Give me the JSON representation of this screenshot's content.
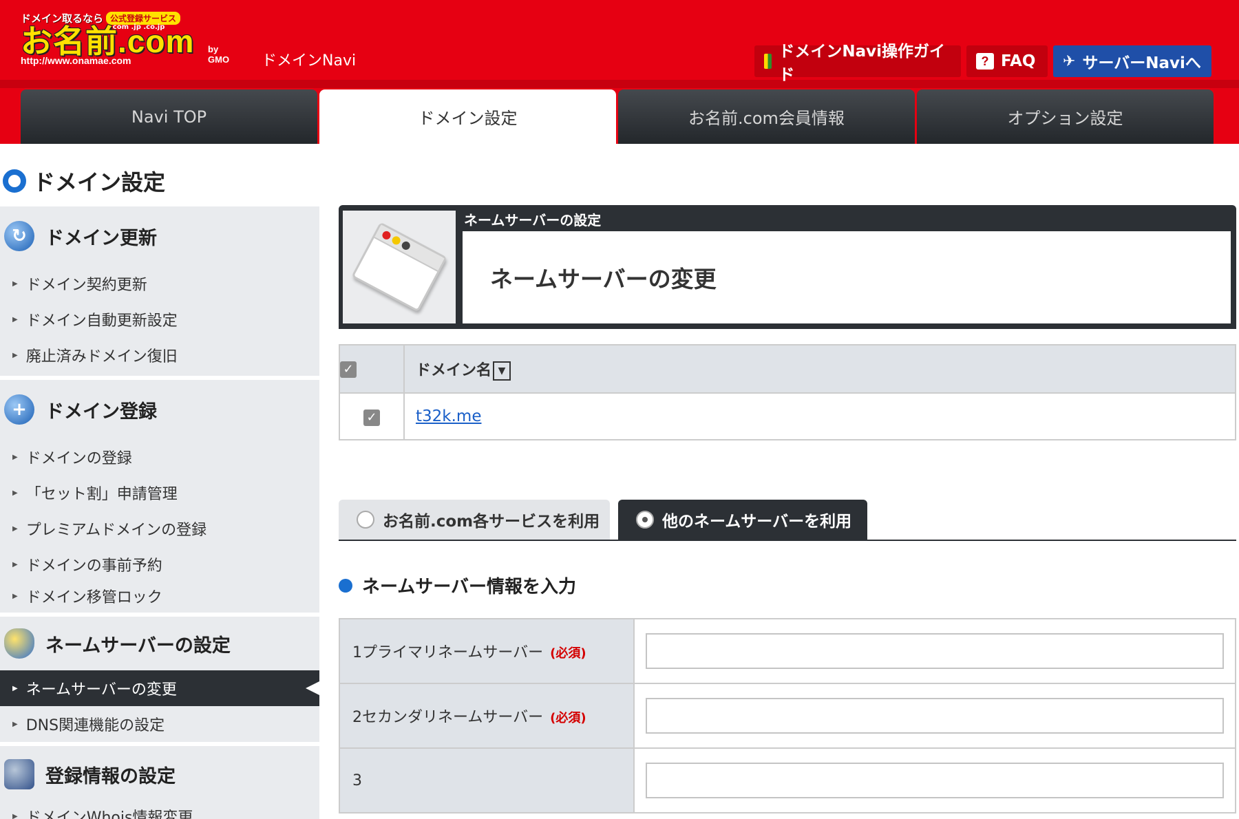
{
  "header": {
    "logo_tagline": "ドメイン取るなら",
    "logo_badge": "公式登録サービス",
    "logo_text": "お名前.com",
    "logo_tlds": ".com .jp .co.jp",
    "logo_url": "http://www.onamae.com",
    "logo_by": "by GMO",
    "app_name": "ドメインNavi",
    "buttons": {
      "guide": "ドメインNavi操作ガイド",
      "faq": "FAQ",
      "server": "サーバーNaviへ"
    },
    "tabs": [
      "Navi TOP",
      "ドメイン設定",
      "お名前.com会員情報",
      "オプション設定"
    ],
    "active_tab": "ドメイン設定",
    "colors": {
      "brand_red": "#e60012",
      "server_blue": "#1f4fa8"
    }
  },
  "page_title": "ドメイン設定",
  "sidebar": {
    "sections": [
      {
        "title": "ドメイン更新",
        "icon": "renew-icon",
        "items": [
          "ドメイン契約更新",
          "ドメイン自動更新設定",
          "廃止済みドメイン復旧"
        ]
      },
      {
        "title": "ドメイン登録",
        "icon": "plus-icon",
        "items": [
          "ドメインの登録",
          "「セット割」申請管理",
          "プレミアムドメインの登録",
          "ドメインの事前予約",
          "ドメイン移管ロック"
        ]
      },
      {
        "title": "ネームサーバーの設定",
        "icon": "nameserver-icon",
        "items": [
          "ネームサーバーの変更",
          "DNS関連機能の設定"
        ],
        "active_item": "ネームサーバーの変更"
      },
      {
        "title": "登録情報の設定",
        "icon": "registration-icon",
        "items": [
          "ドメインWhois情報変更"
        ]
      }
    ]
  },
  "main": {
    "panel_label": "ネームサーバーの設定",
    "panel_title": "ネームサーバーの変更",
    "domain_table": {
      "header": "ドメイン名",
      "sort_symbol": "▼",
      "rows": [
        {
          "checked": true,
          "domain": "t32k.me"
        }
      ]
    },
    "options": {
      "inactive": "お名前.com各サービスを利用",
      "active": "他のネームサーバーを利用"
    },
    "section_heading": "ネームサーバー情報を入力",
    "ns_fields": [
      {
        "label": "1プライマリネームサーバー",
        "required": "(必須)",
        "value": ""
      },
      {
        "label": "2セカンダリネームサーバー",
        "required": "(必須)",
        "value": ""
      },
      {
        "label": "3",
        "required": "",
        "value": ""
      }
    ]
  }
}
